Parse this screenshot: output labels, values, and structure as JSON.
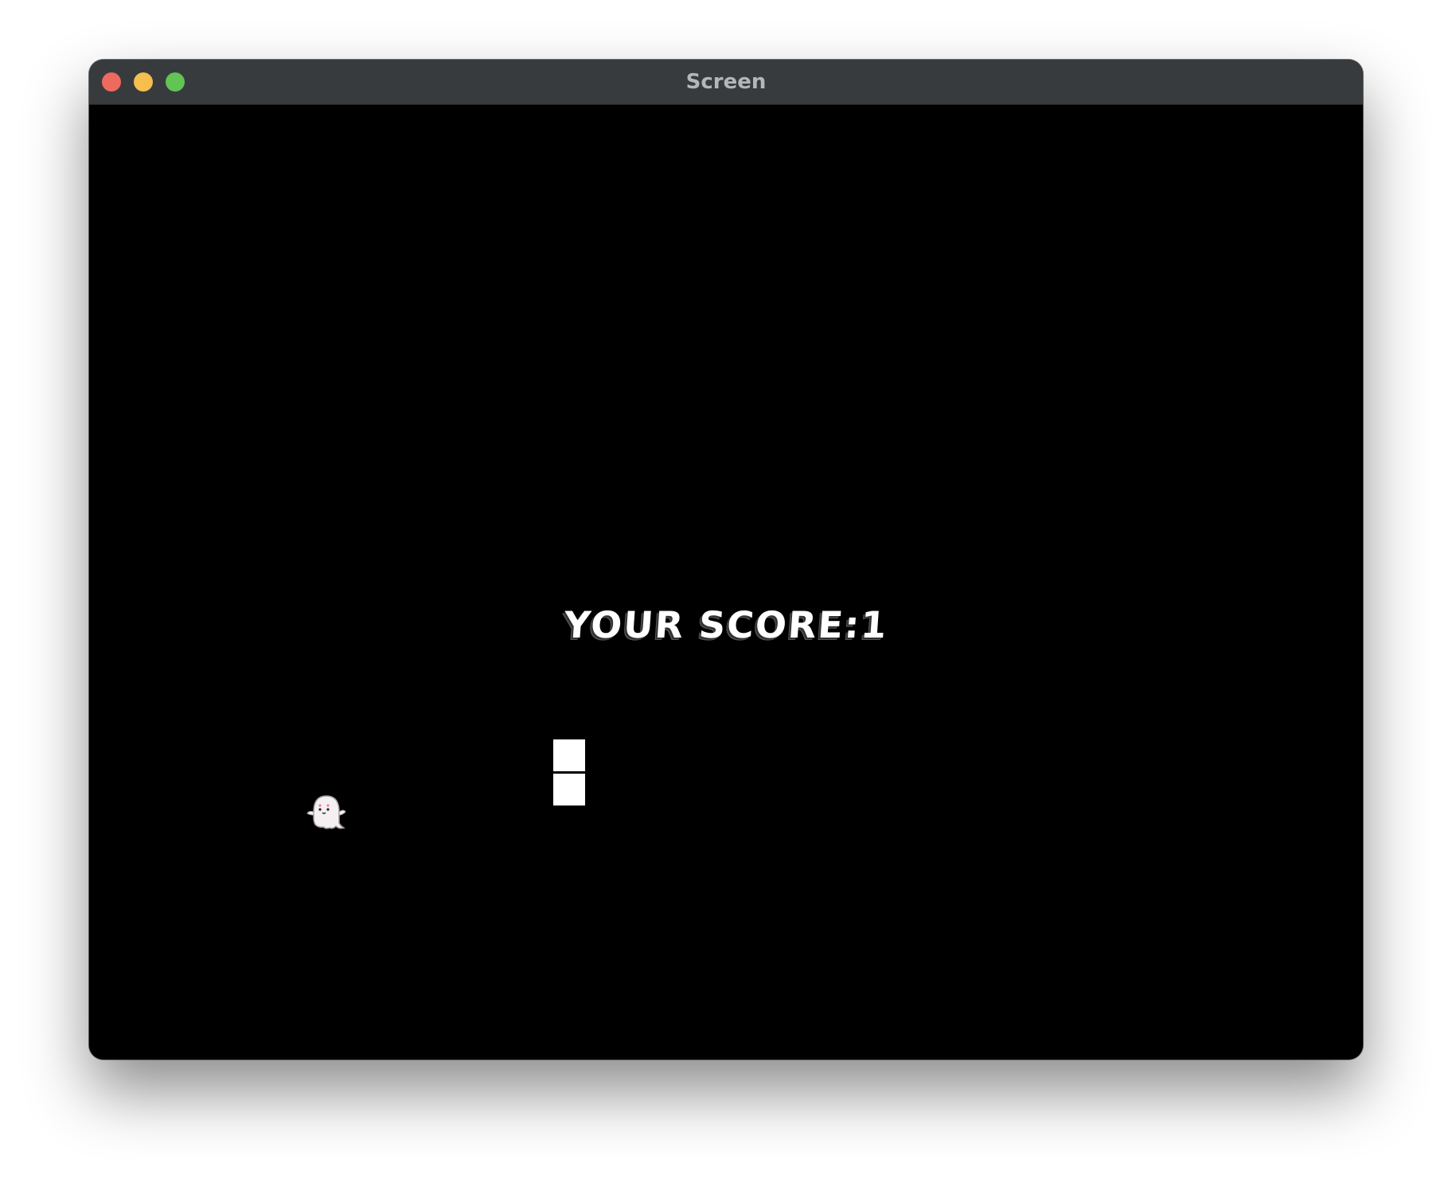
{
  "window": {
    "title": "Screen"
  },
  "game": {
    "score_text": "YOUR SCORE:1",
    "player_icon": "ghost-icon",
    "obstacle": "stacked-white-blocks"
  },
  "colors": {
    "background": "#000000",
    "titlebar": "#383b3d",
    "title_text": "#b4b6b7",
    "foreground": "#ffffff",
    "ghost_cheeks": "#ff6fae"
  }
}
